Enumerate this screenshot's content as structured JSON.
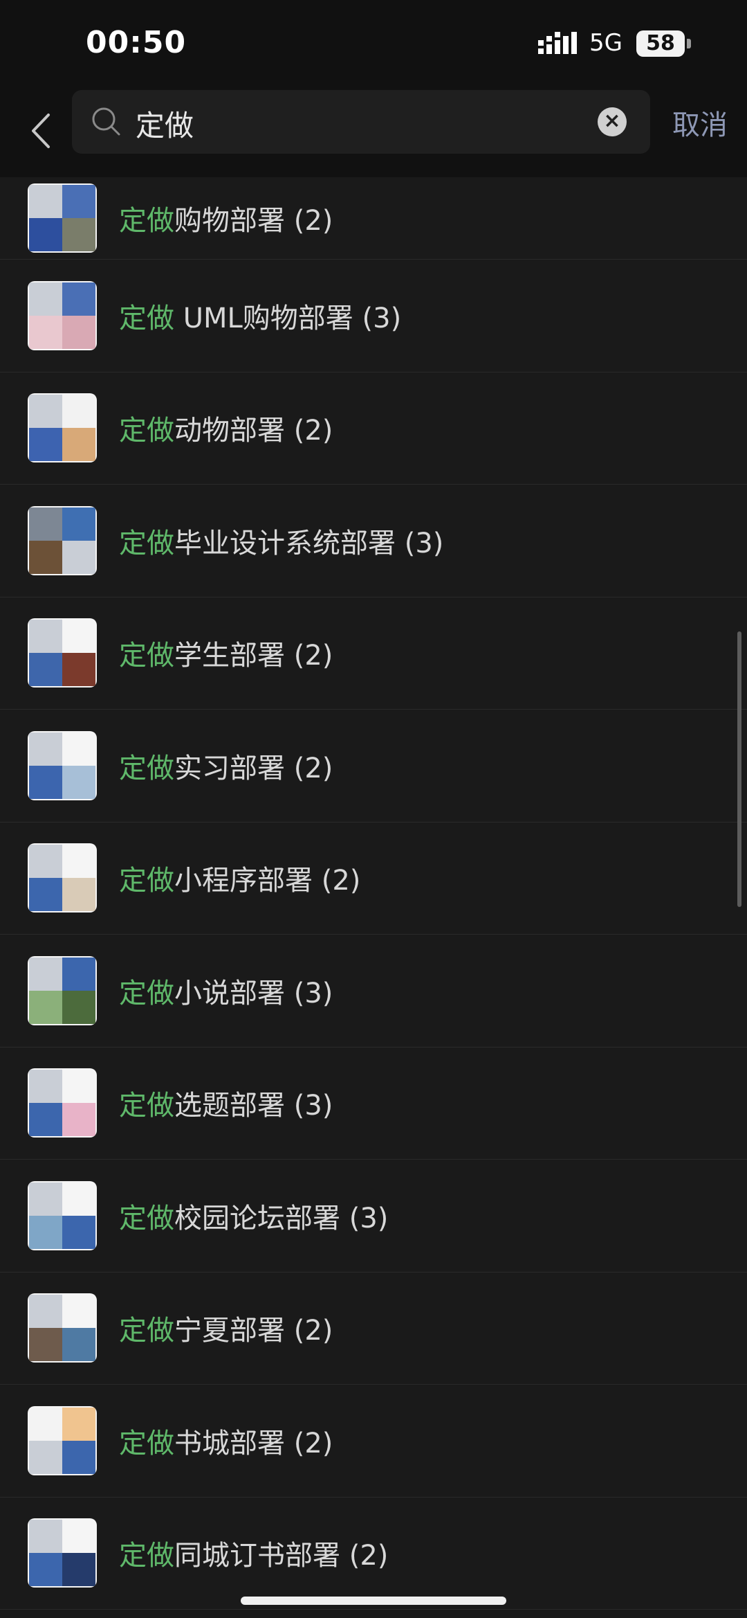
{
  "status": {
    "time": "00:50",
    "network": "5G",
    "battery": "58"
  },
  "search": {
    "query": "定做",
    "cancel_label": "取消"
  },
  "colors": {
    "keyword": "#5fb86a",
    "background": "#1a1a1a",
    "cancel": "#8e98b5"
  },
  "results": [
    {
      "keyword": "定做",
      "name": "购物部署",
      "count": "(2)"
    },
    {
      "keyword": "定做",
      "name": " UML购物部署",
      "count": "(3)"
    },
    {
      "keyword": "定做",
      "name": "动物部署",
      "count": "(2)"
    },
    {
      "keyword": "定做",
      "name": "毕业设计系统部署",
      "count": "(3)"
    },
    {
      "keyword": "定做",
      "name": "学生部署",
      "count": "(2)"
    },
    {
      "keyword": "定做",
      "name": "实习部署",
      "count": "(2)"
    },
    {
      "keyword": "定做",
      "name": "小程序部署",
      "count": "(2)"
    },
    {
      "keyword": "定做",
      "name": "小说部署",
      "count": "(3)"
    },
    {
      "keyword": "定做",
      "name": "选题部署",
      "count": "(3)"
    },
    {
      "keyword": "定做",
      "name": "校园论坛部署",
      "count": "(3)"
    },
    {
      "keyword": "定做",
      "name": "宁夏部署",
      "count": "(2)"
    },
    {
      "keyword": "定做",
      "name": "书城部署",
      "count": "(2)"
    },
    {
      "keyword": "定做",
      "name": "同城订书部署",
      "count": "(2)"
    }
  ]
}
